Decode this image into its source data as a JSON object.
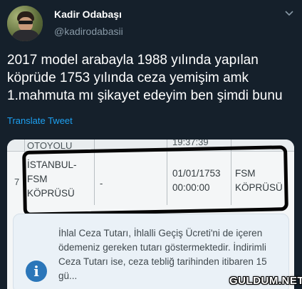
{
  "tweet": {
    "author_name": "Kadir Odabaşı",
    "author_handle": "@kadirodabasii",
    "text": "2017 model arabayla 1988 yılında yapılan köprüde 1753 yılında ceza yemişim amk 1.mahmuta mı şikayet edeyim ben şimdi bunu",
    "translate_label": "Translate Tweet"
  },
  "media": {
    "header_left": "OTOYOLU",
    "header_time": "19:37:39",
    "row_index": "7",
    "location_line1": "İSTANBUL-",
    "location_line2": "FSM",
    "location_line3": "KÖPRÜSÜ",
    "dash": "-",
    "date": "01/01/1753",
    "time": "00:00:00",
    "plaza_line1": "FSM",
    "plaza_line2": "KÖPRÜSÜ",
    "info_text": "İhlal Ceza Tutarı, İhlalli Geçiş Ücreti'ni de içeren ödemeniz gereken tutarı göstermektedir. İndirimli Ceza Tutarı ise, ceza tebliğ tarihinden itibaren 15 gü...",
    "info_icon": "i"
  },
  "watermark": "GULDUM.NET"
}
